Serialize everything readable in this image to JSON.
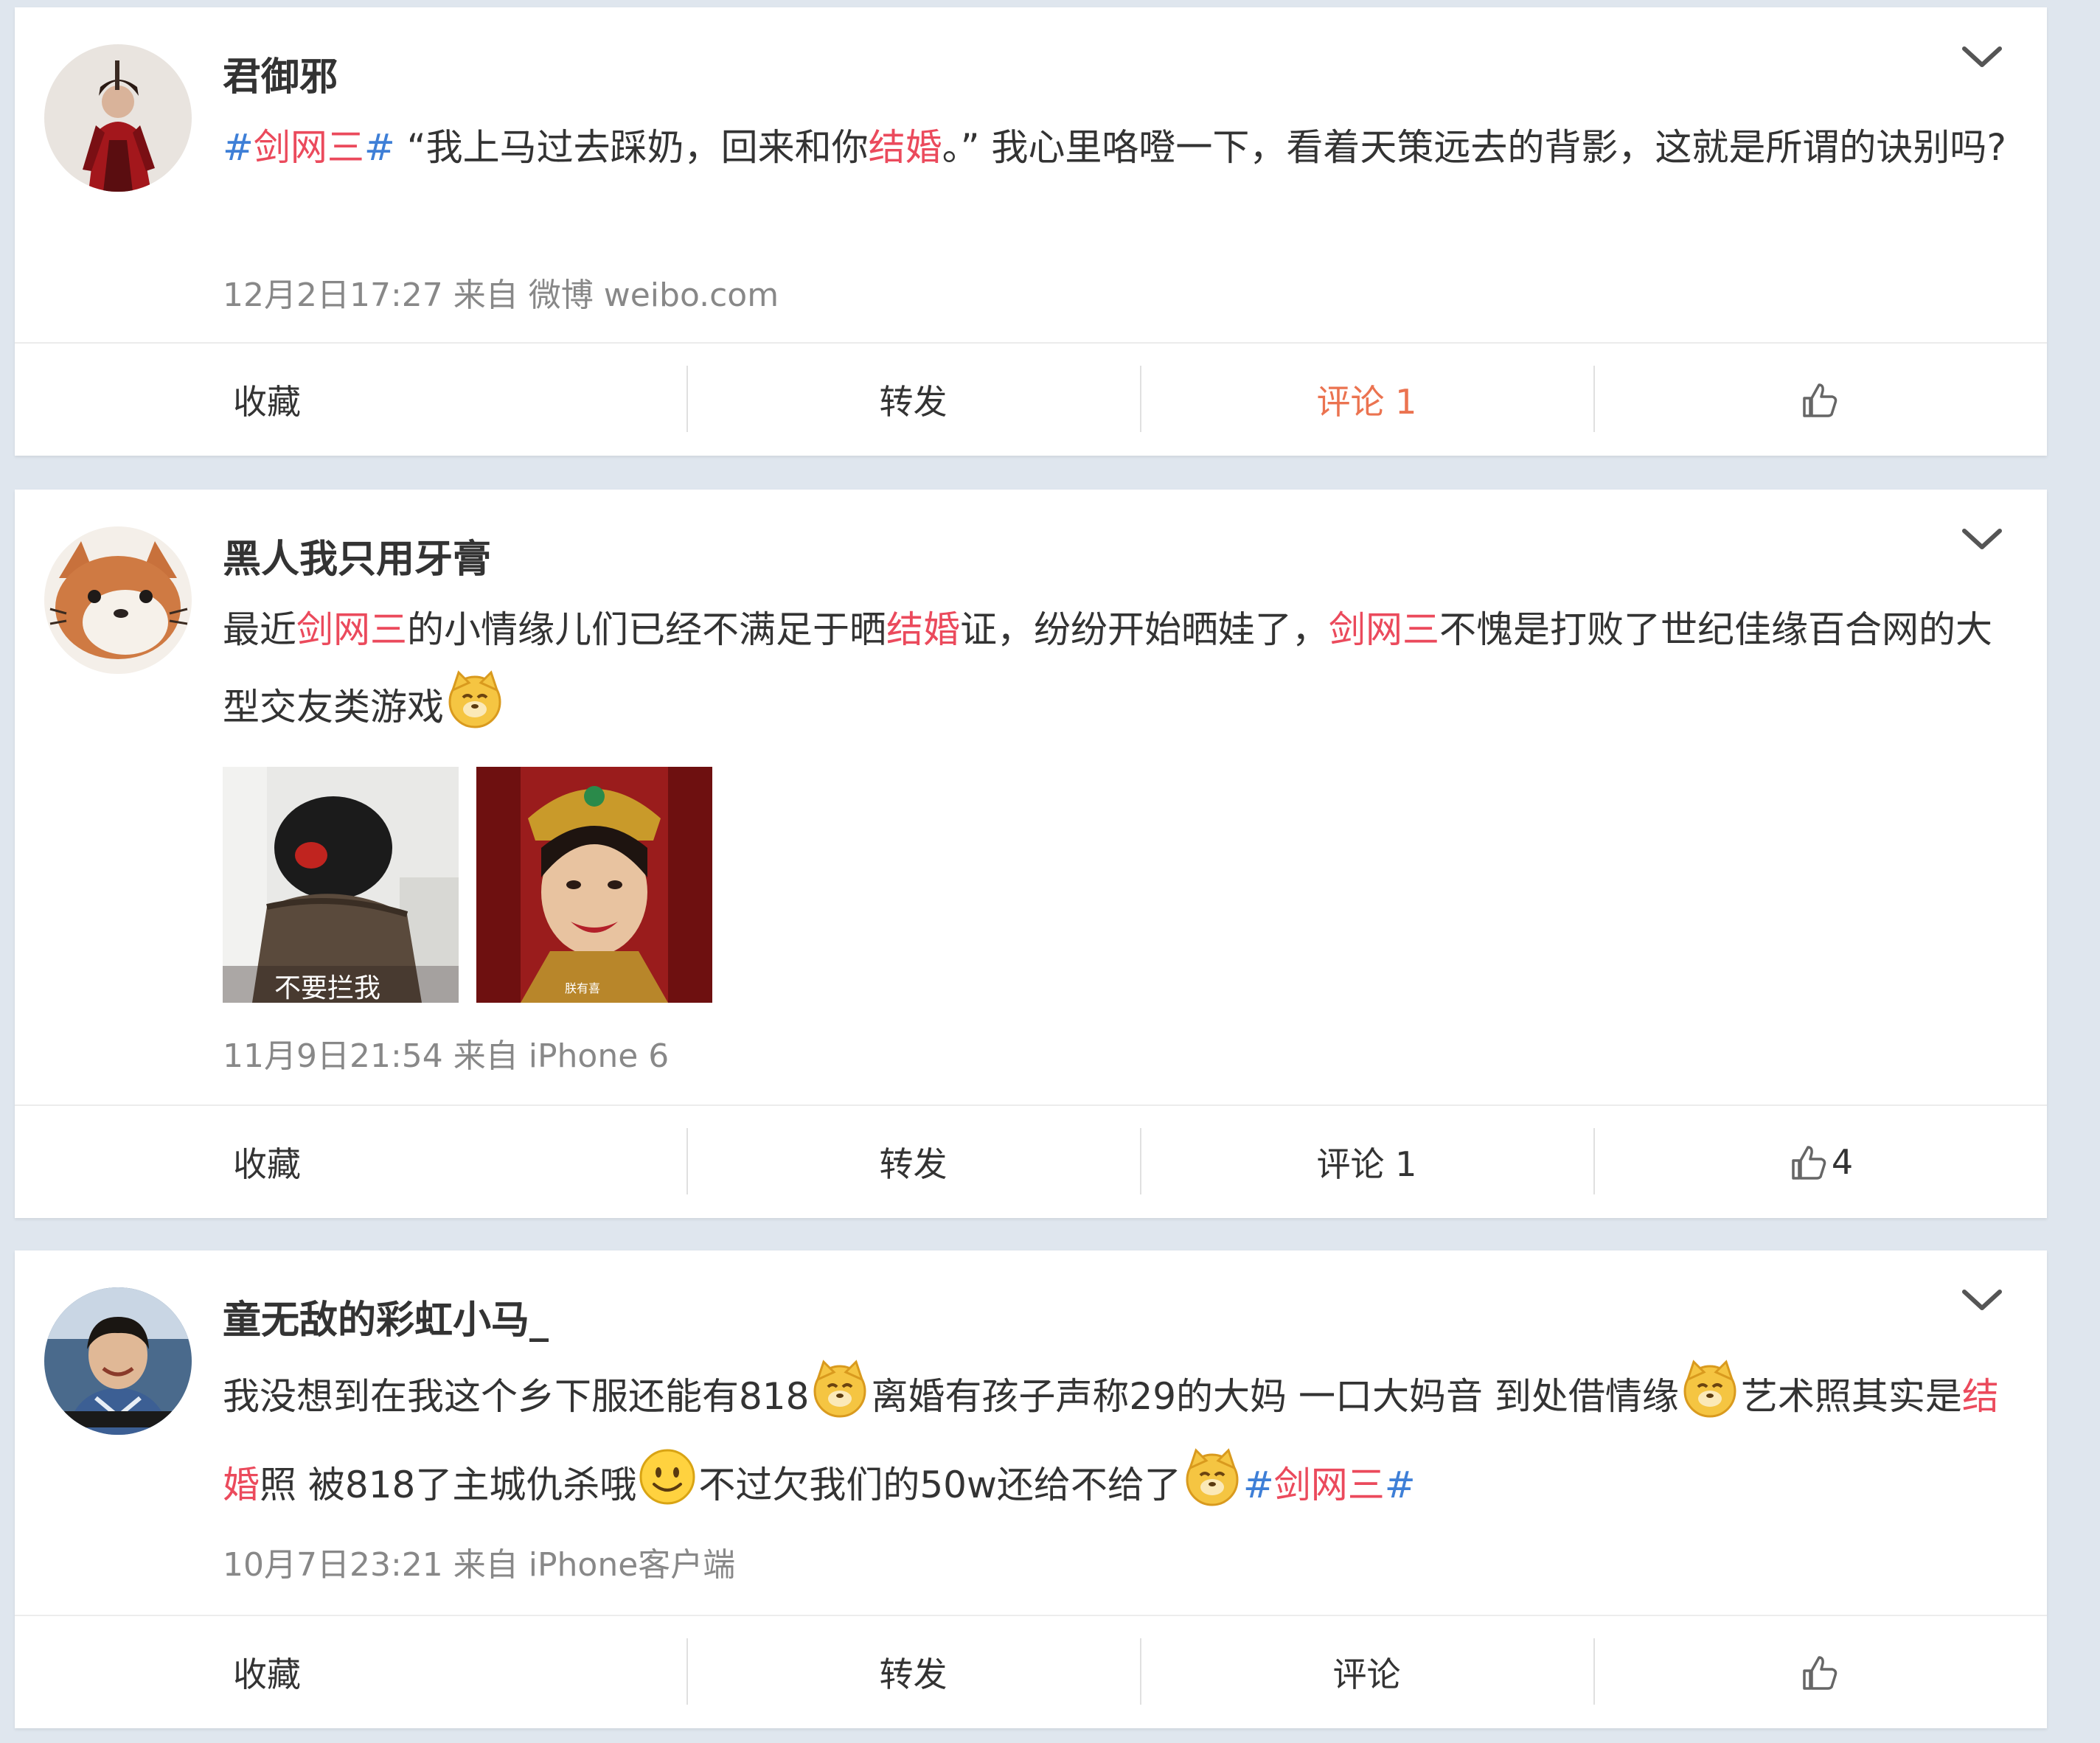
{
  "accent_colors": {
    "topic": "#eb4a5c",
    "hashtag": "#3e7fd7",
    "active_comment": "#eb7350"
  },
  "posts": [
    {
      "username": "君御邪",
      "avatar_icon": "warrior-avatar",
      "text": {
        "t0": "#",
        "t1": "剑网三",
        "t2": "#",
        "t3": " “我上马过去踩奶，回来和你",
        "t4": "结婚",
        "t5": "。” 我心里咯噔一下，看着天策远去的背影，这就是所谓的诀别吗?"
      },
      "meta": "12月2日17:27 来自 微博 weibo.com",
      "actions": {
        "favorite": "收藏",
        "repost": "转发",
        "comment": "评论 1",
        "like_count": ""
      }
    },
    {
      "username": "黑人我只用牙膏",
      "avatar_icon": "cartoon-cat-avatar",
      "text": {
        "t0": "最近",
        "t1": "剑网三",
        "t2": "的小情缘儿们已经不满足于晒",
        "t3": "结婚",
        "t4": "证，纷纷开始晒娃了，",
        "t5": "剑网三",
        "t6": "不愧是打败了世纪佳缘百合网的大型交友类游戏"
      },
      "emoji_1": "doge-emoji",
      "images": [
        {
          "caption": "不要拦我",
          "icon": "kumamon-image"
        },
        {
          "caption": "朕有喜",
          "icon": "empress-image"
        }
      ],
      "meta": "11月9日21:54 来自 iPhone 6",
      "actions": {
        "favorite": "收藏",
        "repost": "转发",
        "comment": "评论 1",
        "like_count": "4"
      }
    },
    {
      "username": "童无敌的彩虹小马_",
      "avatar_icon": "young-man-avatar",
      "text": {
        "t0": "我没想到在我这个乡下服还能有818",
        "t1": "离婚有孩子声称29的大妈 一口大妈音 到处借情缘",
        "t2": "艺术照其实是",
        "t3": "结婚",
        "t4": "照 被818了主城仇杀哦",
        "t5": "不过欠我们的50w还给不给了",
        "t6": "#",
        "t7": "剑网三",
        "t8": "#"
      },
      "meta": "10月7日23:21 来自 iPhone客户端",
      "actions": {
        "favorite": "收藏",
        "repost": "转发",
        "comment": "评论",
        "like_count": ""
      }
    }
  ]
}
